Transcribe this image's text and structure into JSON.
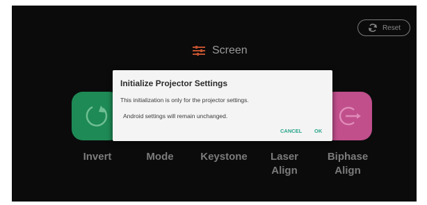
{
  "reset": {
    "label": "Reset",
    "icon": "reset-icon"
  },
  "header": {
    "title": "Screen",
    "icon": "sliders-icon"
  },
  "tiles": {
    "invert": {
      "label": "Invert",
      "icon": "rotate-icon",
      "color": "#1e8a55"
    },
    "mode": {
      "label": "Mode"
    },
    "keystone": {
      "label": "Keystone"
    },
    "laser_align": {
      "label_line1": "Laser",
      "label_line2": "Align"
    },
    "biphase_align": {
      "label_line1": "Biphase",
      "label_line2": "Align",
      "icon": "biphase-icon",
      "color": "#c04f8c"
    }
  },
  "dialog": {
    "title": "Initialize Projector Settings",
    "line1": "This initialization is only for the projector settings.",
    "line2": "Android settings will remain unchanged.",
    "cancel_label": "CANCEL",
    "ok_label": "OK",
    "accent": "#2aa58a"
  }
}
